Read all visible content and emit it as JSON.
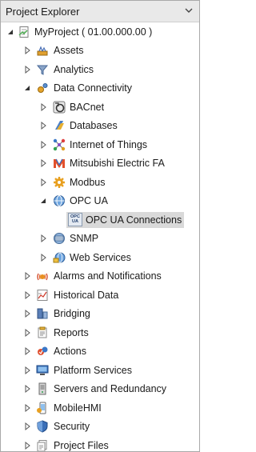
{
  "panel": {
    "title": "Project Explorer"
  },
  "tree": {
    "root": "MyProject ( 01.00.000.00 )",
    "items": [
      {
        "label": "Assets",
        "icon": "assets-icon"
      },
      {
        "label": "Analytics",
        "icon": "analytics-icon"
      },
      {
        "label": "Data Connectivity",
        "icon": "data-connectivity-icon",
        "children": [
          {
            "label": "BACnet",
            "icon": "bacnet-icon"
          },
          {
            "label": "Databases",
            "icon": "databases-icon"
          },
          {
            "label": "Internet of Things",
            "icon": "iot-icon"
          },
          {
            "label": "Mitsubishi Electric FA",
            "icon": "mitsubishi-icon"
          },
          {
            "label": "Modbus",
            "icon": "modbus-icon"
          },
          {
            "label": "OPC UA",
            "icon": "opc-ua-icon",
            "children": [
              {
                "label": "OPC UA Connections",
                "icon": "opc-ua-connections-icon",
                "icon_text": "OPC UA"
              }
            ]
          },
          {
            "label": "SNMP",
            "icon": "snmp-icon"
          },
          {
            "label": "Web Services",
            "icon": "web-services-icon"
          }
        ]
      },
      {
        "label": "Alarms and Notifications",
        "icon": "alarms-icon"
      },
      {
        "label": "Historical Data",
        "icon": "historical-data-icon"
      },
      {
        "label": "Bridging",
        "icon": "bridging-icon"
      },
      {
        "label": "Reports",
        "icon": "reports-icon"
      },
      {
        "label": "Actions",
        "icon": "actions-icon"
      },
      {
        "label": "Platform Services",
        "icon": "platform-services-icon"
      },
      {
        "label": "Servers and Redundancy",
        "icon": "servers-icon"
      },
      {
        "label": "MobileHMI",
        "icon": "mobilehmi-icon"
      },
      {
        "label": "Security",
        "icon": "security-icon"
      },
      {
        "label": "Project Files",
        "icon": "project-files-icon"
      }
    ]
  },
  "colors": {
    "header_bg": "#e9e9e9",
    "selection_bg": "#d9d9d9",
    "text": "#1a1a1a"
  }
}
